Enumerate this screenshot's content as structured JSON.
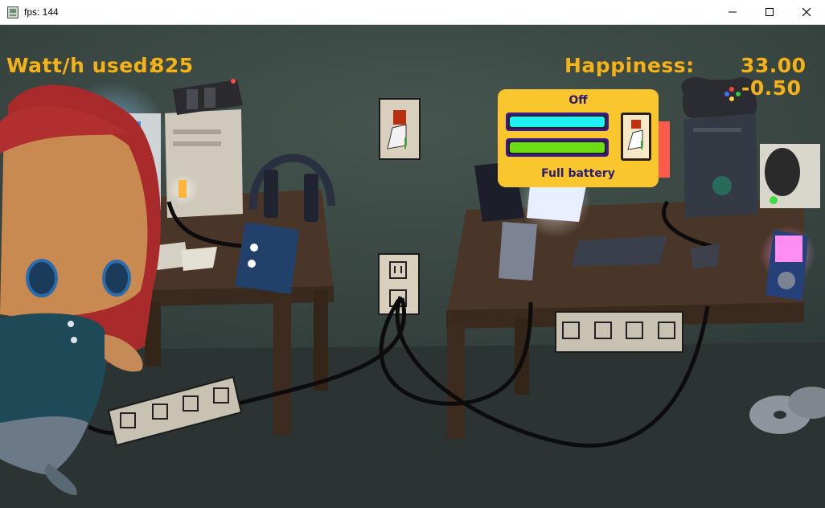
{
  "window": {
    "title": "fps: 144",
    "icons": {
      "app": "app-icon",
      "minimize": "minimize-icon",
      "maximize": "maximize-icon",
      "close": "close-icon"
    }
  },
  "hud": {
    "watt_label": "Watt/h used:",
    "watt_value": "825",
    "happiness_label": "Happiness:",
    "happiness_value": "33.00",
    "happiness_delta": "-0.50"
  },
  "device_popup": {
    "status": "Off",
    "footer": "Full battery",
    "bar1_level": 1.0,
    "bar2_level": 1.0,
    "switch_state": "off",
    "colors": {
      "panel": "#f9c62e",
      "bar1": "#1ff0f4",
      "bar2": "#6cdc14",
      "border": "#3b1a8f",
      "text": "#2c1a6e"
    }
  },
  "colors": {
    "hud_text": "#f2b21c",
    "wall": "#3b4a47",
    "floor": "#2b3432",
    "desk": "#4a3628"
  }
}
